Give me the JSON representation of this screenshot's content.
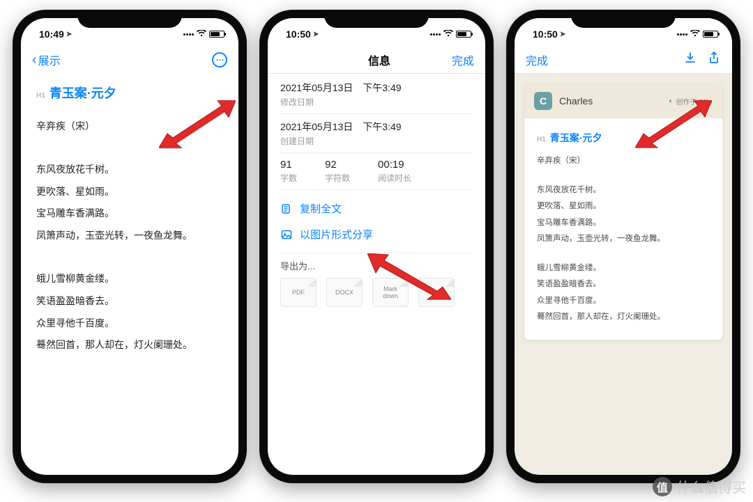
{
  "statusbar": {
    "time1": "10:49",
    "time2": "10:50",
    "time3": "10:50"
  },
  "screen1": {
    "back_label": "展示",
    "doc_title_prefix": "H1",
    "doc_title": "青玉案·元夕",
    "author": "辛弃疾（宋）",
    "stanza1": [
      "东风夜放花千树。",
      "更吹落、星如雨。",
      "宝马雕车香满路。",
      "凤箫声动，玉壶光转，一夜鱼龙舞。"
    ],
    "stanza2": [
      "蛾儿雪柳黄金缕。",
      "笑语盈盈暗香去。",
      "众里寻他千百度。",
      "蓦然回首，那人却在，灯火阑珊处。"
    ]
  },
  "screen2": {
    "title": "信息",
    "done": "完成",
    "modified_date": "2021年05月13日",
    "modified_time": "下午3:49",
    "modified_label": "修改日期",
    "created_date": "2021年05月13日",
    "created_time": "下午3:49",
    "created_label": "创建日期",
    "stat_words": "91",
    "stat_words_label": "字数",
    "stat_chars": "92",
    "stat_chars_label": "字符数",
    "stat_read": "00:19",
    "stat_read_label": "阅读时长",
    "copy_all": "复制全文",
    "share_image": "以图片形式分享",
    "export_label": "导出为...",
    "export_pdf": "PDF",
    "export_docx": "DOCX",
    "export_md": "Mark\ndown",
    "export_other": "..."
  },
  "screen3": {
    "done": "完成",
    "author_name": "Charles",
    "made_with": "创作于 Effie",
    "doc_title_prefix": "H1",
    "doc_title": "青玉案·元夕",
    "author": "辛弃疾（宋）",
    "stanza1": [
      "东风夜放花千树。",
      "更吹落、星如雨。",
      "宝马雕车香满路。",
      "凤箫声动，玉壶光转，一夜鱼龙舞。"
    ],
    "stanza2": [
      "蛾儿雪柳黄金缕。",
      "笑语盈盈暗香去。",
      "众里寻他千百度。",
      "蓦然回首，那人却在，灯火阑珊处。"
    ]
  },
  "watermark": "什么值得买"
}
